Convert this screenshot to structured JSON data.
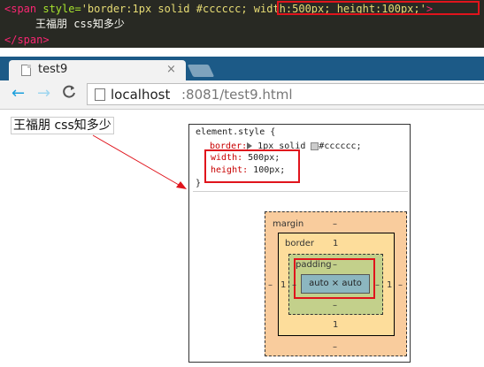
{
  "code": {
    "tag_open": "<span",
    "attr_name": " style=",
    "attr_value_start": "'border:1px solid #cccccc;",
    "attr_value_highlight": " width:500px; height:100px;",
    "attr_value_end": "'",
    "tag_open_close": ">",
    "content": "王福朋 css知多少",
    "tag_close": "</span>"
  },
  "browser": {
    "tab_title": "test9",
    "tab_close": "×",
    "back_icon": "←",
    "forward_icon": "→",
    "reload_icon": "C",
    "url_host": "localhost",
    "url_rest": ":8081/test9.html"
  },
  "page": {
    "span_text": "王福朋 css知多少"
  },
  "devtools": {
    "selector": "element.style {",
    "border_prop": "border:",
    "border_value": " 1px solid ",
    "border_color": "#cccccc;",
    "width_prop": "width:",
    "width_value": " 500px;",
    "height_prop": "height:",
    "height_value": " 100px;",
    "close_brace": "}",
    "box_model": {
      "margin_label": "margin",
      "margin_top": "–",
      "margin_bottom": "–",
      "margin_left": "–",
      "margin_right": "–",
      "border_label": "border",
      "border_top": "1",
      "border_bottom": "1",
      "border_left": "1",
      "border_right": "1",
      "padding_label": "padding",
      "padding_top": "–",
      "padding_bottom": "–",
      "padding_left": "–",
      "padding_right": "–",
      "content": "auto × auto"
    }
  },
  "colors": {
    "highlight_red": "#e0141c",
    "browser_frame": "#1c5a87",
    "code_bg": "#282923"
  }
}
